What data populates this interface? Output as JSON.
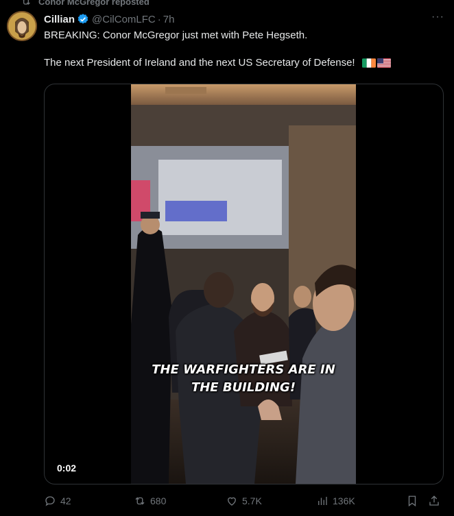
{
  "repost_banner": {
    "text": "Conor McGregor reposted",
    "icon": "repost-icon"
  },
  "author": {
    "name": "Cillian",
    "handle": "@CilComLFC",
    "separator": "·",
    "time": "7h",
    "verified": true
  },
  "more_label": "···",
  "tweet": {
    "line1": "BREAKING: Conor McGregor just met with Pete Hegseth.",
    "line2": "The next President of Ireland and the next US Secretary of Defense!",
    "emojis": [
      "flag-ireland",
      "flag-united-states"
    ]
  },
  "video": {
    "caption_line1": "THE WARFIGHTERS ARE IN",
    "caption_line2": "THE BUILDING!",
    "timestamp": "0:02"
  },
  "actions": {
    "reply_count": "42",
    "repost_count": "680",
    "like_count": "5.7K",
    "view_count": "136K"
  },
  "colors": {
    "accent": "#1d9bf0",
    "muted": "#71767b",
    "text": "#e7e9ea",
    "background": "#000000"
  }
}
